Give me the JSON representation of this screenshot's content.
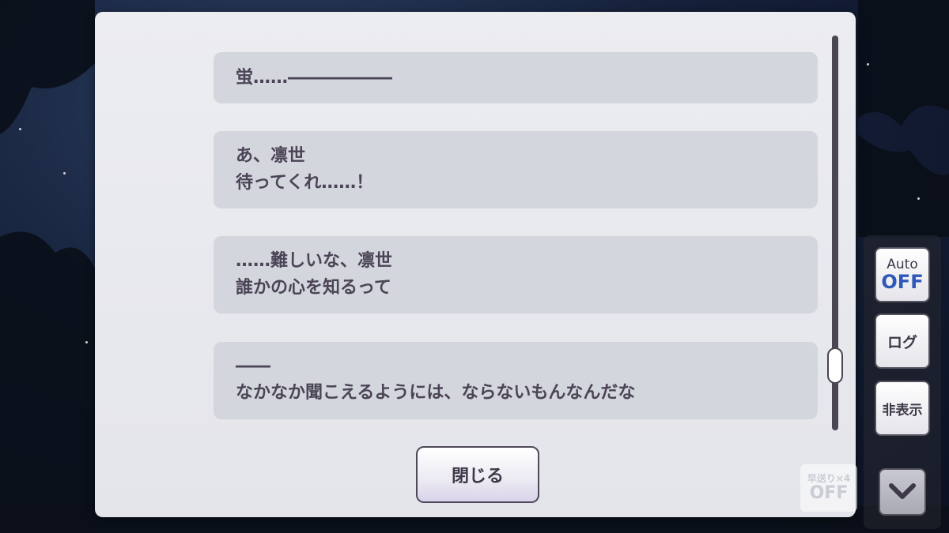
{
  "log_entries": [
    {
      "lines": [
        "蛍……――――――"
      ]
    },
    {
      "lines": [
        "あ、凛世",
        "待ってくれ……！"
      ]
    },
    {
      "lines": [
        "……難しいな、凛世",
        "誰かの心を知るって"
      ]
    },
    {
      "lines": [
        "――",
        "なかなか聞こえるようには、ならないもんなんだな"
      ]
    }
  ],
  "close_button": {
    "label": "閉じる"
  },
  "side_controls": {
    "auto": {
      "label": "Auto",
      "state": "OFF",
      "state_color": "#2f58b8"
    },
    "log": {
      "label": "ログ"
    },
    "hide": {
      "label": "非表示"
    }
  },
  "speed": {
    "label": "早送り×4",
    "state": "OFF"
  },
  "scroll": {
    "position_fraction": 0.9
  },
  "icons": {
    "down": "chevron-down-icon"
  }
}
